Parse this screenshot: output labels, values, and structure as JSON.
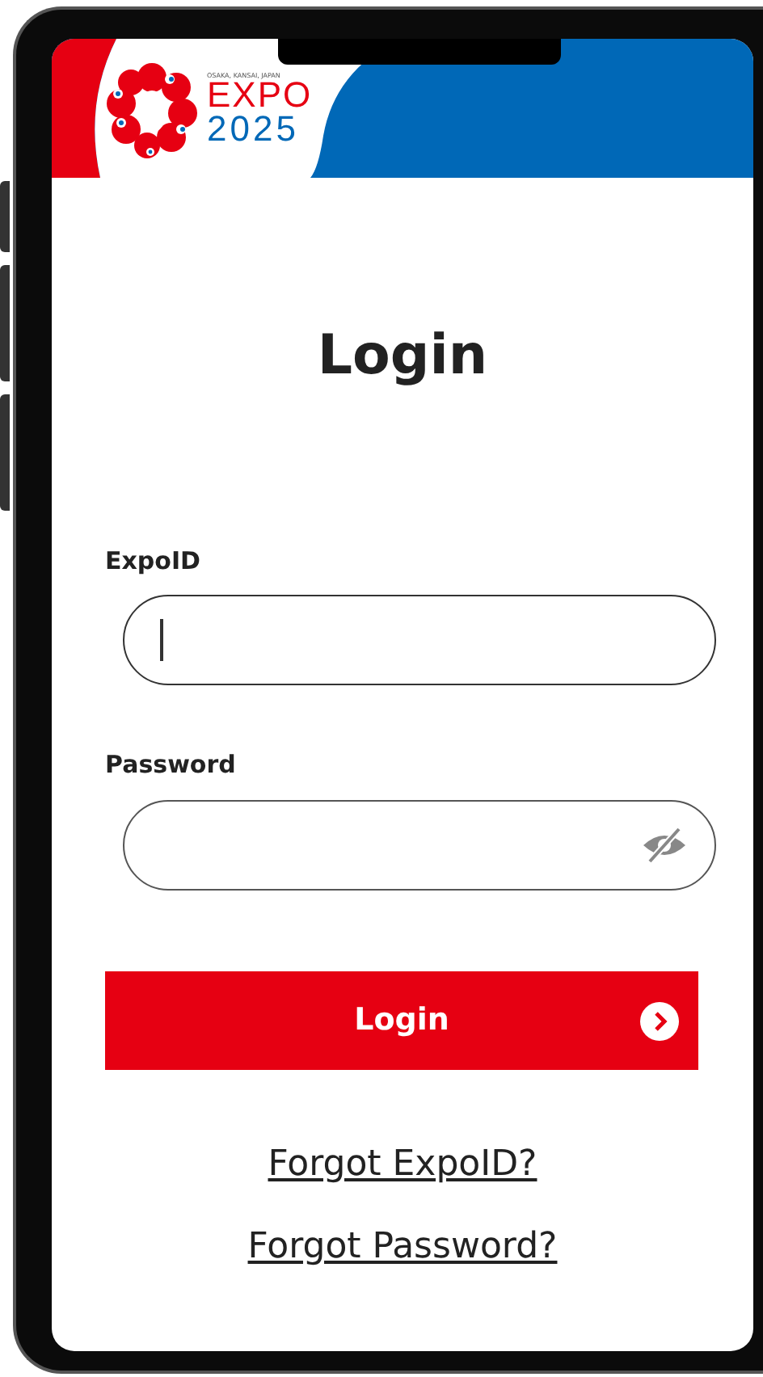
{
  "header": {
    "logo_tagline": "OSAKA, KANSAI, JAPAN",
    "logo_word": "EXPO",
    "logo_year": "2025"
  },
  "title": "Login",
  "fields": [
    {
      "kind": "text",
      "label": "ExpoID",
      "focused": true
    },
    {
      "kind": "password",
      "label": "Password",
      "focused": false,
      "password_visible": false
    }
  ],
  "login_button": {
    "label": "Login"
  },
  "links": [
    "Forgot ExpoID?",
    "Forgot Password?"
  ]
}
